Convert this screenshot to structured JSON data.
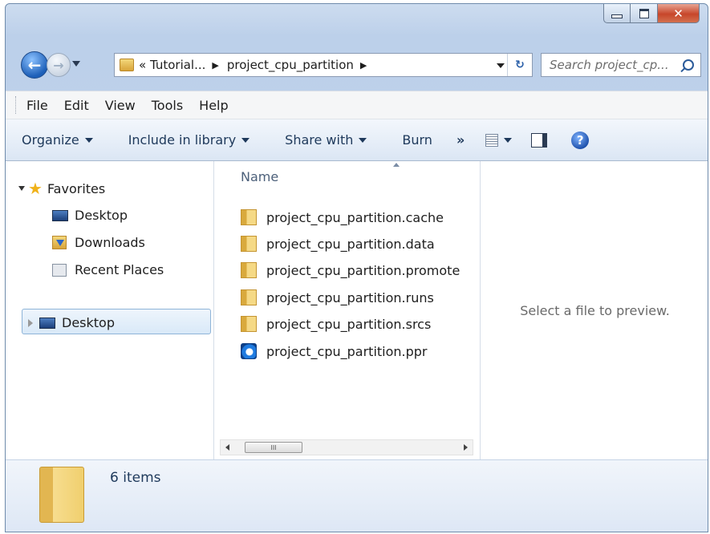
{
  "window": {
    "controls": {
      "minimize": "minimize",
      "maximize": "maximize",
      "close": "✕"
    }
  },
  "nav": {
    "back_glyph": "←",
    "forward_glyph": "→",
    "address": {
      "crumbs": [
        "« Tutorial...",
        "project_cpu_partition"
      ],
      "separator": "▶"
    },
    "refresh_glyph": "↻",
    "search_placeholder": "Search project_cp..."
  },
  "menubar": {
    "items": [
      "File",
      "Edit",
      "View",
      "Tools",
      "Help"
    ]
  },
  "commandbar": {
    "organize": "Organize",
    "include": "Include in library",
    "share": "Share with",
    "burn": "Burn",
    "more": "»",
    "help": "?"
  },
  "navpane": {
    "favorites": "Favorites",
    "favorites_items": [
      "Desktop",
      "Downloads",
      "Recent Places"
    ],
    "desktop_root": "Desktop"
  },
  "filelist": {
    "column_header": "Name",
    "items": [
      {
        "name": "project_cpu_partition.cache",
        "icon": "folder-icon"
      },
      {
        "name": "project_cpu_partition.data",
        "icon": "folder-icon"
      },
      {
        "name": "project_cpu_partition.promote",
        "icon": "folder-icon"
      },
      {
        "name": "project_cpu_partition.runs",
        "icon": "folder-icon"
      },
      {
        "name": "project_cpu_partition.srcs",
        "icon": "folder-icon"
      },
      {
        "name": "project_cpu_partition.ppr",
        "icon": "vivado-project-icon"
      }
    ],
    "scroll_thumb": "III"
  },
  "preview": {
    "message": "Select a file to preview."
  },
  "details": {
    "count": "6 items"
  }
}
